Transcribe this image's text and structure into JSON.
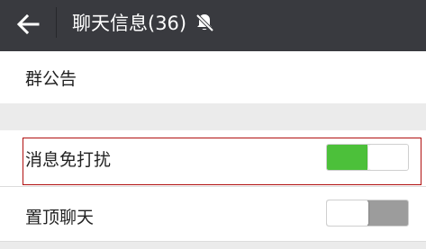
{
  "header": {
    "title": "聊天信息(36)",
    "back_icon": "arrow-left-icon",
    "mute_icon": "bell-off-icon"
  },
  "settings": {
    "group_notice": {
      "label": "群公告"
    },
    "do_not_disturb": {
      "label": "消息免打扰",
      "enabled": true
    },
    "pin_chat": {
      "label": "置顶聊天",
      "enabled": false
    }
  },
  "colors": {
    "header_bg": "#393a3f",
    "toggle_on": "#4cc03a",
    "toggle_off": "#9c9c9c",
    "highlight_border": "#b01010"
  }
}
